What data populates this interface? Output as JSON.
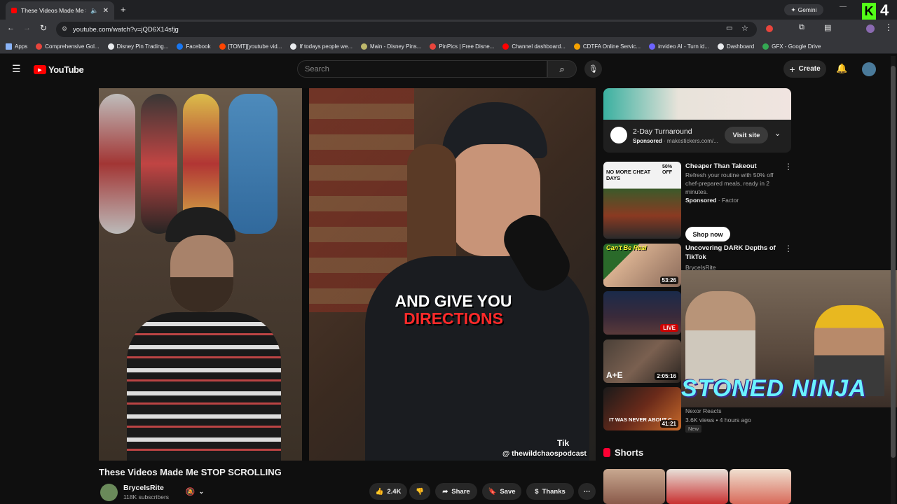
{
  "browser": {
    "tab_title": "These Videos Made Me STOP SCROLLING - YouTube",
    "new_tab": "+",
    "gemini_label": "Gemini",
    "url": "youtube.com/watch?v=jQD6X14sfjg",
    "bookmarks": [
      {
        "label": "Apps",
        "color": "#8ab4f8"
      },
      {
        "label": "Comprehensive Gol...",
        "color": "#e8453c"
      },
      {
        "label": "Disney Pin Trading...",
        "color": "#e8eaed"
      },
      {
        "label": "Facebook",
        "color": "#1877f2"
      },
      {
        "label": "[TOMT][youtube vid...",
        "color": "#ff4500"
      },
      {
        "label": "If todays people we...",
        "color": "#e8eaed"
      },
      {
        "label": "Main - Disney Pins...",
        "color": "#bdb76b"
      },
      {
        "label": "PinPics | Free Disne...",
        "color": "#e8453c"
      },
      {
        "label": "Channel dashboard...",
        "color": "#ff0000"
      },
      {
        "label": "CDTFA Online Servic...",
        "color": "#f4a100"
      },
      {
        "label": "invideo AI - Turn id...",
        "color": "#6c63ff"
      },
      {
        "label": "Dashboard",
        "color": "#e8eaed"
      },
      {
        "label": "GFX - Google Drive",
        "color": "#34a853"
      }
    ]
  },
  "header": {
    "logo_text": "YouTube",
    "search_placeholder": "Search",
    "create_label": "Create"
  },
  "player": {
    "caption_line1": "AND GIVE YOU",
    "caption_line2": "DIRECTIONS",
    "handle": "@ thewildchaospodcast",
    "watermark": "Tik"
  },
  "video": {
    "title": "These Videos Made Me STOP SCROLLING",
    "channel": "BryceIsRite",
    "subscribers": "118K subscribers",
    "likes": "2.4K",
    "share_label": "Share",
    "save_label": "Save",
    "thanks_label": "Thanks"
  },
  "ad": {
    "title": "2-Day Turnaround",
    "sponsored": "Sponsored",
    "domain": "makestickers.com/...",
    "visit_label": "Visit site"
  },
  "recommendations": [
    {
      "title": "Cheaper Than Takeout",
      "description": "Refresh your routine with 50% off chef-prepared meals, ready in 2 minutes.",
      "sponsored": "Sponsored",
      "advertiser": "Factor",
      "cta": "Shop now",
      "thumb_text": "NO MORE CHEAT DAYS",
      "thumb_badge": "50% OFF"
    },
    {
      "title": "Uncovering DARK Depths of TikTok",
      "channel": "BryceIsRite",
      "duration": "53:26",
      "thumb_text": "Can't Be Real"
    },
    {
      "live": "LIVE"
    },
    {
      "duration": "2:05:16",
      "thumb_text": "A+E"
    },
    {
      "duration": "41:21",
      "channel": "Nexor Reacts",
      "views": "3.6K views • 4 hours ago",
      "badge": "New",
      "thumb_text": "IT WAS NEVER ABOUT C"
    }
  ],
  "overlay": {
    "text": "STONED NINJA"
  },
  "shorts": {
    "title": "Shorts"
  }
}
